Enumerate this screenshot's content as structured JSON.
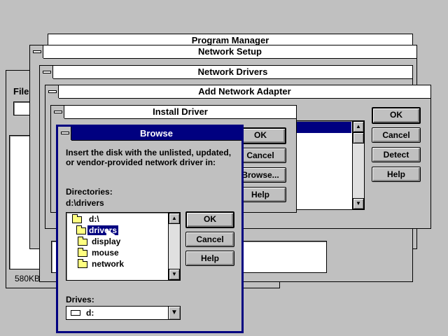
{
  "desktop": {
    "color": "#c0c0c0"
  },
  "program_manager": {
    "title": "Program Manager",
    "menu_file": "File",
    "status": "580KB"
  },
  "network_setup": {
    "title": "Network Setup"
  },
  "network_drivers": {
    "title": "Network Drivers"
  },
  "add_network_adapter": {
    "title": "Add Network Adapter",
    "ok": "OK",
    "cancel": "Cancel",
    "detect": "Detect",
    "help": "Help"
  },
  "install_driver": {
    "title": "Install Driver",
    "ok": "OK",
    "cancel": "Cancel",
    "browse": "Browse...",
    "help": "Help"
  },
  "browse": {
    "title": "Browse",
    "instruction": "Insert the disk with the unlisted, updated, or vendor-provided network driver in:",
    "directories_label": "Directories:",
    "current_path": "d:\\drivers",
    "directories": [
      {
        "label": "d:\\",
        "open": true,
        "selected": false
      },
      {
        "label": "drivers",
        "open": true,
        "selected": true
      },
      {
        "label": "display",
        "open": false,
        "selected": false
      },
      {
        "label": "mouse",
        "open": false,
        "selected": false
      },
      {
        "label": "network",
        "open": false,
        "selected": false
      }
    ],
    "drives_label": "Drives:",
    "drive_value": "d:",
    "ok": "OK",
    "cancel": "Cancel",
    "help": "Help"
  },
  "colors": {
    "active_title": "#000080",
    "selection": "#000080",
    "window": "#c0c0c0"
  }
}
